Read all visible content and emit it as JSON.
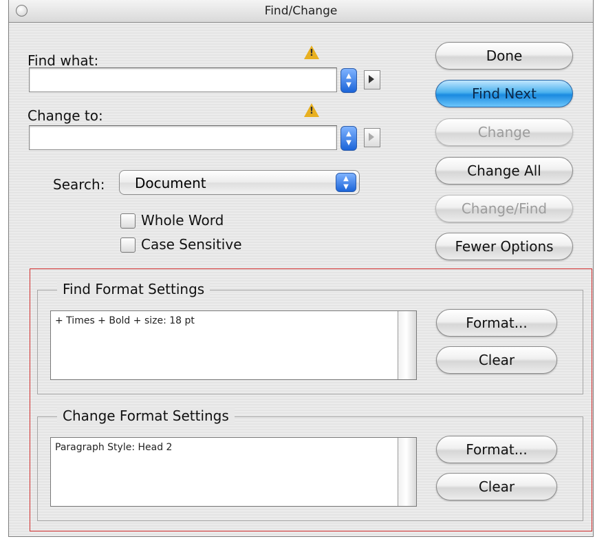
{
  "window": {
    "title": "Find/Change"
  },
  "find": {
    "label": "Find what:",
    "value": ""
  },
  "change": {
    "label": "Change to:",
    "value": ""
  },
  "search": {
    "label": "Search:",
    "value": "Document"
  },
  "options": {
    "whole_word": "Whole Word",
    "case_sensitive": "Case Sensitive"
  },
  "buttons": {
    "done": "Done",
    "find_next": "Find Next",
    "change": "Change",
    "change_all": "Change All",
    "change_find": "Change/Find",
    "fewer_options": "Fewer Options"
  },
  "find_format": {
    "title": "Find Format Settings",
    "text": "+ Times + Bold + size: 18 pt",
    "format": "Format...",
    "clear": "Clear"
  },
  "change_format": {
    "title": "Change Format Settings",
    "text": "Paragraph Style: Head 2",
    "format": "Format...",
    "clear": "Clear"
  },
  "icons": {
    "warning": "warning-icon",
    "stepper": "stepper-icon",
    "menu_arrow": "menu-arrow-icon"
  },
  "colors": {
    "default_button": "#1a8ae0",
    "highlight_box": "#d12a2a"
  }
}
